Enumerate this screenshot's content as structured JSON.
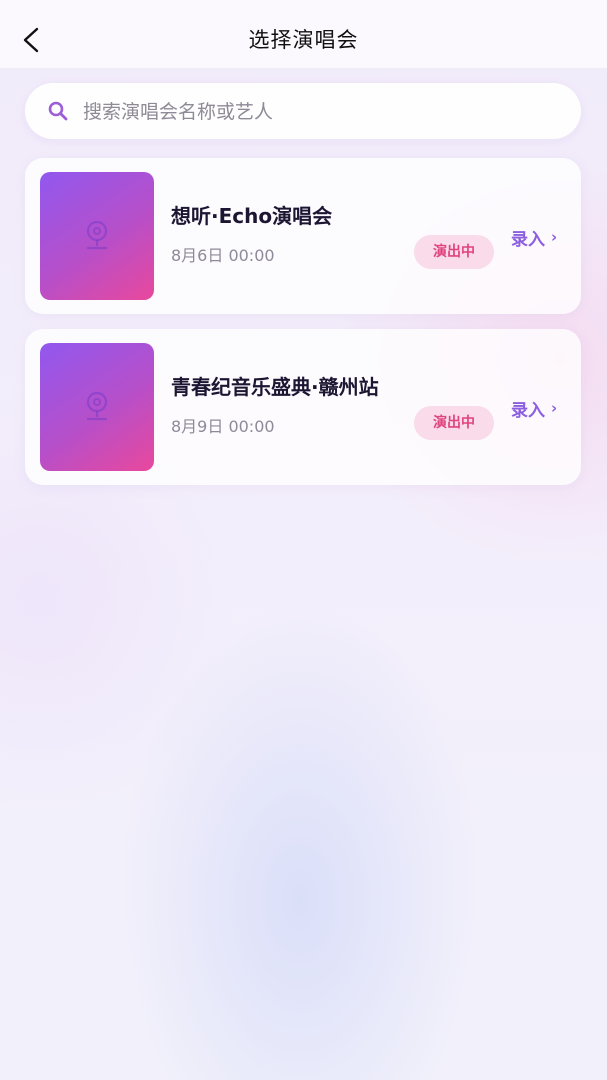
{
  "header": {
    "title": "选择演唱会",
    "back_icon": "chevron-left-icon"
  },
  "search": {
    "placeholder": "搜索演唱会名称或艺人",
    "icon": "search-icon",
    "accent_color": "#9b5ed6"
  },
  "concerts": [
    {
      "title": "想听·Echo演唱会",
      "datetime": "8月6日 00:00",
      "status": "演出中",
      "action_label": "录入",
      "action_chevron": "›",
      "thumb_icon": "map-pin-icon"
    },
    {
      "title": "青春纪音乐盛典·赣州站",
      "datetime": "8月9日 00:00",
      "status": "演出中",
      "action_label": "录入",
      "action_chevron": "›",
      "thumb_icon": "map-pin-icon"
    }
  ],
  "colors": {
    "status_text": "#e0447f",
    "status_bg": "#f9dbe9",
    "action": "#8c5ee0",
    "thumb_gradient_start": "#9158ef",
    "thumb_gradient_end": "#e9489c"
  }
}
